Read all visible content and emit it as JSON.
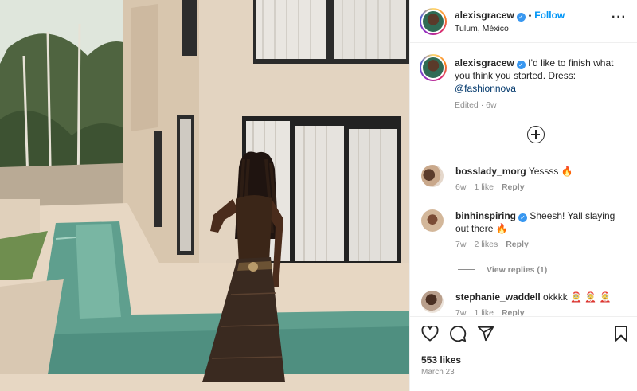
{
  "post": {
    "username": "alexisgracew",
    "verified_mark": "✓",
    "separator": "•",
    "follow_label": "Follow",
    "location": "Tulum, México",
    "more_label": "···"
  },
  "caption": {
    "username": "alexisgracew",
    "text": "I’d like to finish what you think you started. Dress:",
    "mention": "@fashionnova",
    "meta": "Edited · 6w"
  },
  "comments": [
    {
      "username": "bosslady_morg",
      "verified": false,
      "text": "Yessss 🔥",
      "time": "6w",
      "likes": "1 like",
      "reply": "Reply"
    },
    {
      "username": "binhinspiring",
      "verified": true,
      "text": "Sheesh! Yall slaying out there 🔥",
      "time": "7w",
      "likes": "2 likes",
      "reply": "Reply"
    },
    {
      "username": "stephanie_waddell",
      "verified": false,
      "text": "okkkk 🤶 🤶 🤶",
      "time": "7w",
      "likes": "1 like",
      "reply": "Reply"
    }
  ],
  "view_replies": "View replies (1)",
  "actions": {
    "likes": "553 likes",
    "date": "March 23"
  },
  "icons": [
    "heart-icon",
    "comment-icon",
    "share-icon",
    "bookmark-icon",
    "plus-circle-icon",
    "verified-icon",
    "more-icon"
  ],
  "colors": {
    "link": "#0095f6",
    "verified": "#3897f0",
    "muted": "#8e8e8e",
    "mention": "#00376b"
  }
}
